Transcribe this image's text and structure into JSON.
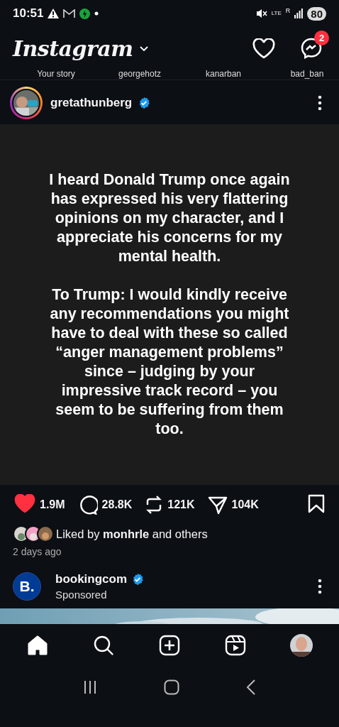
{
  "status_bar": {
    "time": "10:51",
    "network": "LTE",
    "roaming": "R",
    "battery": "80"
  },
  "header": {
    "logo": "Instagram",
    "message_count": "2"
  },
  "stories": [
    {
      "name": "Your story"
    },
    {
      "name": "georgehotz"
    },
    {
      "name": "kanarban"
    },
    {
      "name": "bad_ban"
    }
  ],
  "post": {
    "username": "gretathunberg",
    "verified": true,
    "text": [
      "I heard Donald Trump once again has expressed his very flattering opinions on my character, and I appreciate his concerns for my mental health.",
      "To Trump: I would kindly receive any recommendations you might have to deal with these so called “anger management problems” since – judging by your impressive track record – you seem to be suffering from them too."
    ],
    "liked": true,
    "likes": "1.9M",
    "comments": "28.8K",
    "reposts": "121K",
    "shares": "104K",
    "saved": false,
    "liked_by": "Liked by **monhrle** and others",
    "time": "2 days ago"
  },
  "sponsored_post": {
    "avatar_text": "B.",
    "username": "bookingcom",
    "verified": true,
    "label": "Sponsored"
  },
  "nav": [
    {
      "kind": "home",
      "selected": true
    },
    {
      "kind": "search",
      "selected": false
    },
    {
      "kind": "create",
      "selected": false
    },
    {
      "kind": "reels",
      "selected": false
    },
    {
      "kind": "profile",
      "selected": false
    }
  ]
}
